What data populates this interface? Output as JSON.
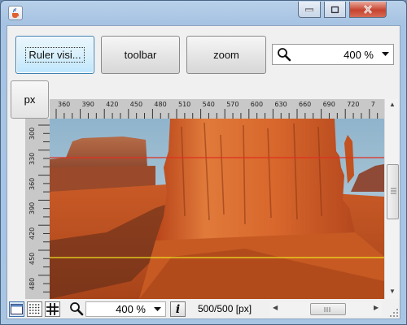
{
  "colors": {
    "titlebar": "#b9d1ea",
    "accent_button": "#bee6fd",
    "close_button": "#c7442f",
    "ruler": "#c8c8c8",
    "guide_red": "#e03020",
    "guide_yellow": "#f0e020"
  },
  "toolbar": {
    "ruler_button_label": "Ruler visi...",
    "toolbar_button_label": "toolbar",
    "zoom_button_label": "zoom",
    "zoom_combo_value": "400 %"
  },
  "corner": {
    "unit_button_label": "px"
  },
  "ruler": {
    "horizontal_labels": [
      "360",
      "390",
      "420",
      "450",
      "480",
      "510",
      "540",
      "570",
      "600",
      "630",
      "660",
      "690",
      "720",
      "7"
    ],
    "vertical_labels": [
      "300",
      "330",
      "360",
      "390",
      "420",
      "450",
      "480"
    ]
  },
  "statusbar": {
    "zoom_value": "400 %",
    "dimensions": "500/500 [px]"
  },
  "icons": {
    "app": "java-cup-icon",
    "search": "magnifier-icon",
    "info": "info-icon",
    "grid": "grid-icon"
  }
}
